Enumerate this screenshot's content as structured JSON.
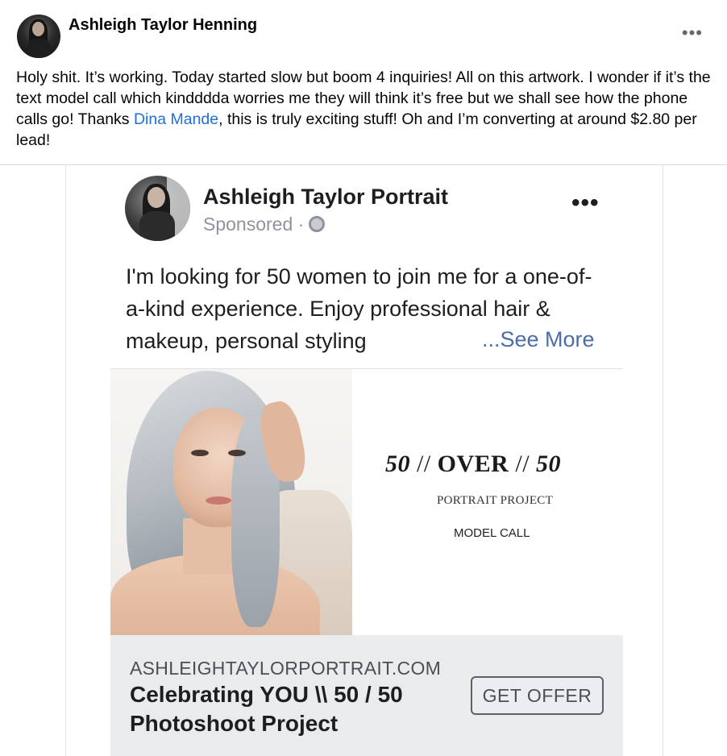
{
  "post": {
    "author": "Ashleigh Taylor Henning",
    "more_icon": "more-horizontal-icon",
    "text_before_mention": "Holy shit. It’s working. Today started slow but boom 4 inquiries! All on this artwork. I wonder if it’s the text model call which kindddda worries me they will think it’s free but we shall see how the phone calls go! Thanks ",
    "mention": "Dina Mande",
    "text_after_mention": ", this is truly exciting stuff! Oh and I’m converting at around $2.80 per lead!",
    "mention_color": "#216fdb"
  },
  "ad": {
    "page_name": "Ashleigh Taylor Portrait",
    "sponsored": "Sponsored ·",
    "privacy_icon": "globe-icon",
    "more_icon": "more-horizontal-icon",
    "body_text": "I'm looking for 50 women to join me for a one-of-a-kind experience. Enjoy professional hair & makeup, personal styling",
    "see_more": "...See More",
    "creative": {
      "title_num1": "50",
      "title_sep1": " // ",
      "title_word": "OVER",
      "title_sep2": " // ",
      "title_num2": "50",
      "subtitle": "PORTRAIT PROJECT",
      "tagline": "MODEL CALL"
    },
    "link": {
      "url": "ASHLEIGHTAYLORPORTRAIT.COM",
      "headline": "Celebrating YOU \\\\ 50 / 50 Photoshoot Project",
      "cta": "GET OFFER"
    }
  }
}
